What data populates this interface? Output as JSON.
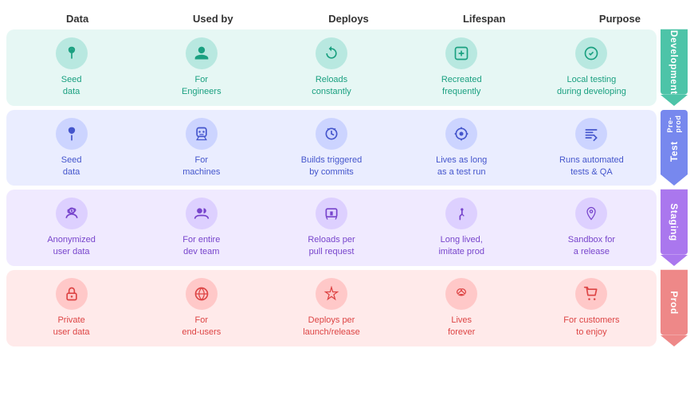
{
  "header": {
    "columns": [
      "Data",
      "Used by",
      "Deploys",
      "Lifespan",
      "Purpose"
    ]
  },
  "rows": [
    {
      "id": "development",
      "label": "Development",
      "bg": "#e6f7f4",
      "icon_bg": "#b8e8e0",
      "text_color": "#1aa080",
      "tag_color": "#4dc4a8",
      "tag_tip": "#4dc4a8",
      "cells": [
        {
          "icon": "🌱",
          "label": "Seed\ndata"
        },
        {
          "icon": "👷",
          "label": "For\nEngineers"
        },
        {
          "icon": "🔄",
          "label": "Reloads\nconstantly"
        },
        {
          "icon": "➕",
          "label": "Recreated\nfrequently"
        },
        {
          "icon": "🔧",
          "label": "Local testing\nduring developing"
        }
      ]
    },
    {
      "id": "test",
      "label": "Pre-prod",
      "sublabel": "Test",
      "bg": "#eaedff",
      "icon_bg": "#ccd4ff",
      "text_color": "#4455cc",
      "tag_color": "#7788ee",
      "tag_tip": "#7788ee",
      "cells": [
        {
          "icon": "🌱",
          "label": "Seed\ndata"
        },
        {
          "icon": "🤖",
          "label": "For\nmachines"
        },
        {
          "icon": "⌚",
          "label": "Builds triggered\nby commits"
        },
        {
          "icon": "⏱",
          "label": "Lives as long\nas a test run"
        },
        {
          "icon": "📋",
          "label": "Runs automated\ntests & QA"
        }
      ]
    },
    {
      "id": "staging",
      "label": "Staging",
      "bg": "#f0eaff",
      "icon_bg": "#ddd0ff",
      "text_color": "#7744cc",
      "tag_color": "#aa77ee",
      "tag_tip": "#aa77ee",
      "cells": [
        {
          "icon": "🕵",
          "label": "Anonymized\nuser data"
        },
        {
          "icon": "👥",
          "label": "For entire\ndev team"
        },
        {
          "icon": "📥",
          "label": "Reloads per\npull request"
        },
        {
          "icon": "🚶",
          "label": "Long lived,\nimitate prod"
        },
        {
          "icon": "☂",
          "label": "Sandbox for\na release"
        }
      ]
    },
    {
      "id": "prod",
      "label": "Prod",
      "bg": "#ffeaea",
      "icon_bg": "#ffc8c8",
      "text_color": "#dd4444",
      "tag_color": "#ee8888",
      "tag_tip": "#ee8888",
      "cells": [
        {
          "icon": "🔒",
          "label": "Private\nuser data"
        },
        {
          "icon": "🌐",
          "label": "For\nend-users"
        },
        {
          "icon": "🚀",
          "label": "Deploys per\nlaunch/release"
        },
        {
          "icon": "∞",
          "label": "Lives\nforever"
        },
        {
          "icon": "🛒",
          "label": "For customers\nto enjoy"
        }
      ]
    }
  ]
}
